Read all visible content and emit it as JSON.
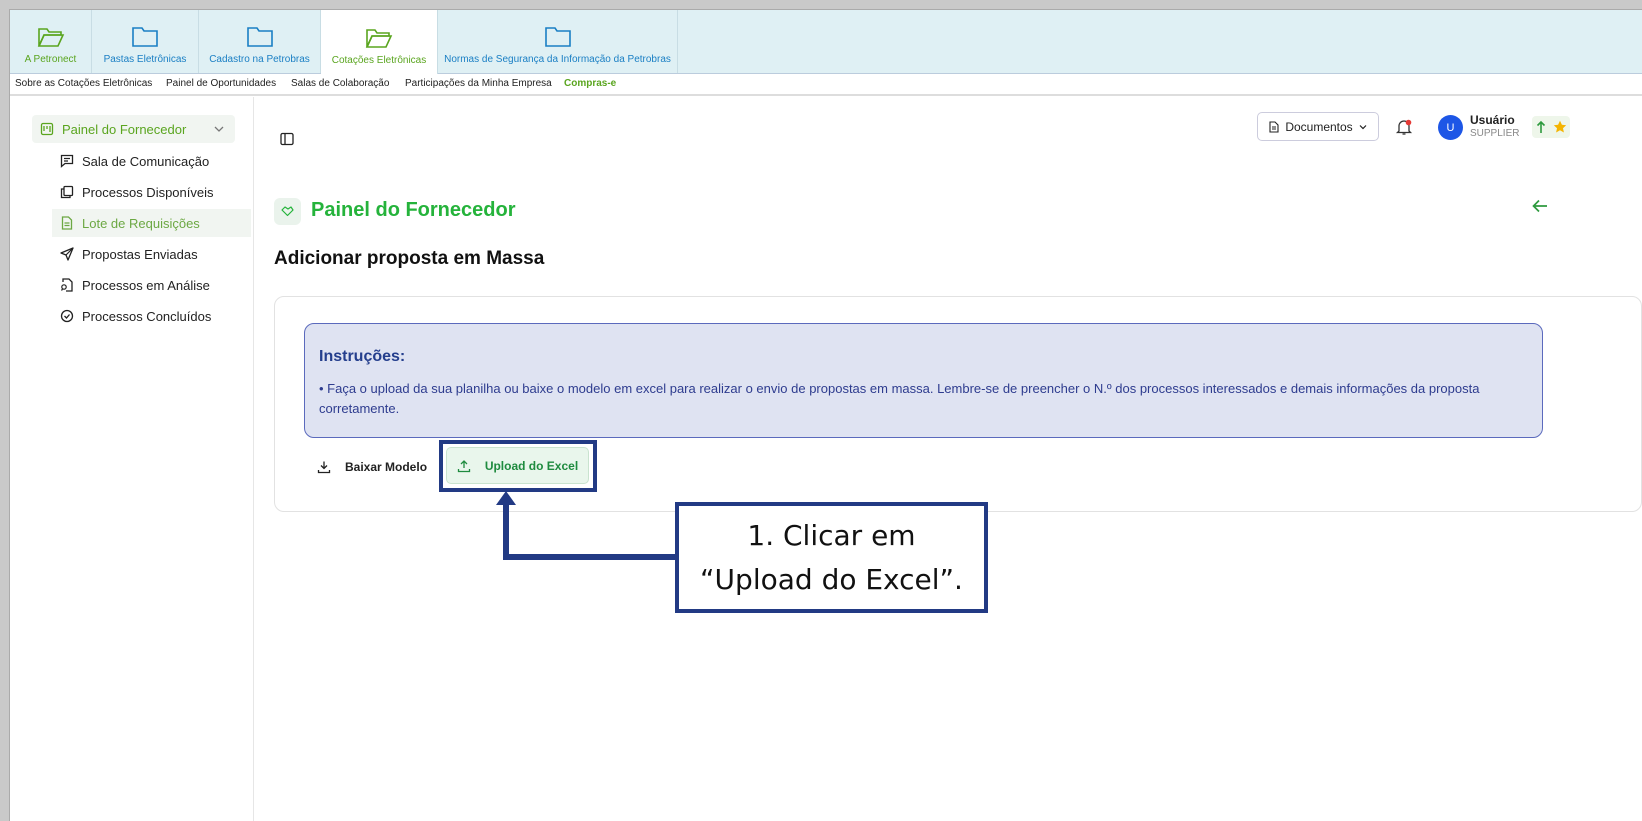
{
  "top_tabs": [
    {
      "label": "A Petronect",
      "icon": "folder-open-icon",
      "color": "#5aa51f"
    },
    {
      "label": "Pastas Eletrônicas",
      "icon": "folder-icon"
    },
    {
      "label": "Cadastro na Petrobras",
      "icon": "folder-icon"
    },
    {
      "label": "Cotações Eletrônicas",
      "icon": "folder-open-icon",
      "active": true,
      "color": "#5aa51f"
    },
    {
      "label": "Normas de Segurança da Informação da Petrobras",
      "icon": "folder-icon"
    }
  ],
  "sub_nav": [
    "Sobre as Cotações Eletrônicas",
    "Painel de Oportunidades",
    "Salas de Colaboração",
    "Participações da Minha Empresa",
    "Compras-e"
  ],
  "sidebar": {
    "header": "Painel do Fornecedor",
    "items": [
      {
        "label": "Sala de Comunicação",
        "icon": "message-icon"
      },
      {
        "label": "Processos Disponíveis",
        "icon": "copy-icon"
      },
      {
        "label": "Lote de Requisições",
        "icon": "file-icon",
        "active": true
      },
      {
        "label": "Propostas Enviadas",
        "icon": "send-icon"
      },
      {
        "label": "Processos em Análise",
        "icon": "file-search-icon"
      },
      {
        "label": "Processos Concluídos",
        "icon": "check-circle-icon"
      }
    ]
  },
  "header": {
    "documents_label": "Documentos",
    "user_initial": "U",
    "user_name": "Usuário",
    "user_role": "SUPPLIER"
  },
  "page": {
    "title": "Painel do Fornecedor",
    "subtitle": "Adicionar proposta em Massa",
    "instructions_title": "Instruções:",
    "instructions_text": "• Faça o upload da sua planilha ou baixe o modelo em excel para realizar o envio de propostas em massa. Lembre-se de preencher o N.º dos processos interessados e demais informações da proposta corretamente.",
    "download_label": "Baixar Modelo",
    "upload_label": "Upload do Excel"
  },
  "callout": {
    "line1": "1. Clicar em",
    "line2": "“Upload do Excel”."
  },
  "colors": {
    "brand_green": "#25b33b",
    "accent_blue": "#223a84",
    "tab_bar": "#dff0f4"
  }
}
